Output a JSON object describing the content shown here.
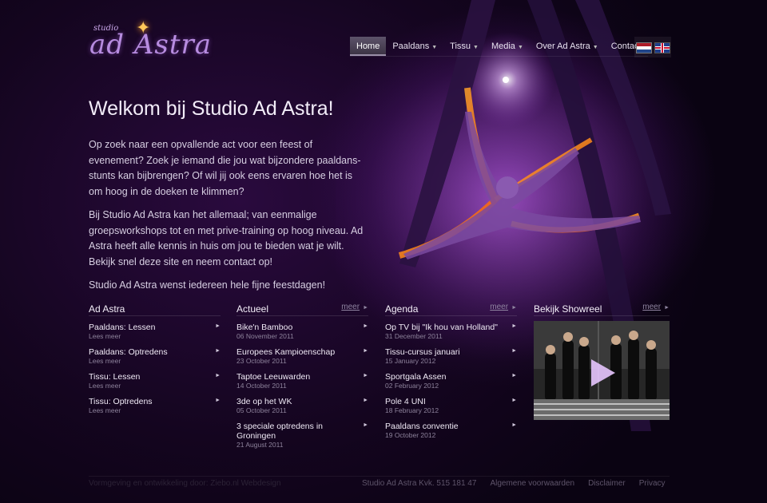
{
  "logo": {
    "small": "studio",
    "big": "ad Astra"
  },
  "nav": {
    "items": [
      {
        "label": "Home",
        "active": true
      },
      {
        "label": "Paaldans",
        "dropdown": true
      },
      {
        "label": "Tissu",
        "dropdown": true
      },
      {
        "label": "Media",
        "dropdown": true
      },
      {
        "label": "Over Ad Astra",
        "dropdown": true
      },
      {
        "label": "Contact"
      }
    ],
    "caret": "▼"
  },
  "languages": [
    "nl-flag-icon",
    "uk-flag-icon"
  ],
  "hero_icon": "aerial-dancer-illustration",
  "headline": "Welkom bij Studio Ad Astra!",
  "intro": {
    "p1": "Op zoek naar een opvallende act voor een feest of evenement? Zoek je iemand die jou wat bijzondere paaldans-stunts kan bijbrengen? Of wil jij ook eens ervaren hoe het is om hoog in de doeken te klimmen?",
    "p2": "Bij Studio Ad Astra kan het allemaal; van eenmalige groepsworkshops tot en met prive-training op hoog niveau. Ad Astra heeft alle kennis in huis om jou te bieden wat je wilt. Bekijk snel deze site en neem contact op!",
    "p3": "Studio Ad Astra wenst iedereen hele fijne feestdagen!"
  },
  "columns": {
    "adastra": {
      "title": "Ad Astra",
      "items": [
        {
          "title": "Paaldans: Lessen",
          "sub": "Lees meer"
        },
        {
          "title": "Paaldans: Optredens",
          "sub": "Lees meer"
        },
        {
          "title": "Tissu: Lessen",
          "sub": "Lees meer"
        },
        {
          "title": "Tissu: Optredens",
          "sub": "Lees meer"
        }
      ]
    },
    "actueel": {
      "title": "Actueel",
      "more": "meer",
      "items": [
        {
          "title": "Bike'n Bamboo",
          "sub": "06 November 2011"
        },
        {
          "title": "Europees Kampioenschap",
          "sub": "23 October 2011"
        },
        {
          "title": "Taptoe Leeuwarden",
          "sub": "14 October 2011"
        },
        {
          "title": "3de op het WK",
          "sub": "05 October 2011"
        },
        {
          "title": "3 speciale optredens in Groningen",
          "sub": "21 August 2011"
        }
      ]
    },
    "agenda": {
      "title": "Agenda",
      "more": "meer",
      "items": [
        {
          "title": "Op TV bij \"Ik hou van Holland\"",
          "sub": "31 December 2011"
        },
        {
          "title": "Tissu-cursus januari",
          "sub": "15 January 2012"
        },
        {
          "title": "Sportgala Assen",
          "sub": "02 February 2012"
        },
        {
          "title": "Pole 4 UNI",
          "sub": "18 February 2012"
        },
        {
          "title": "Paaldans conventie",
          "sub": "19 October 2012"
        }
      ]
    },
    "showreel": {
      "title": "Bekijk Showreel",
      "more": "meer"
    }
  },
  "arrow": "►",
  "footer": {
    "credit": "Vormgeving en ontwikkeling door: Ziebo.nl Webdesign",
    "links": [
      "Studio Ad Astra Kvk. 515 181 47",
      "Algemene voorwaarden",
      "Disclaimer",
      "Privacy"
    ]
  }
}
